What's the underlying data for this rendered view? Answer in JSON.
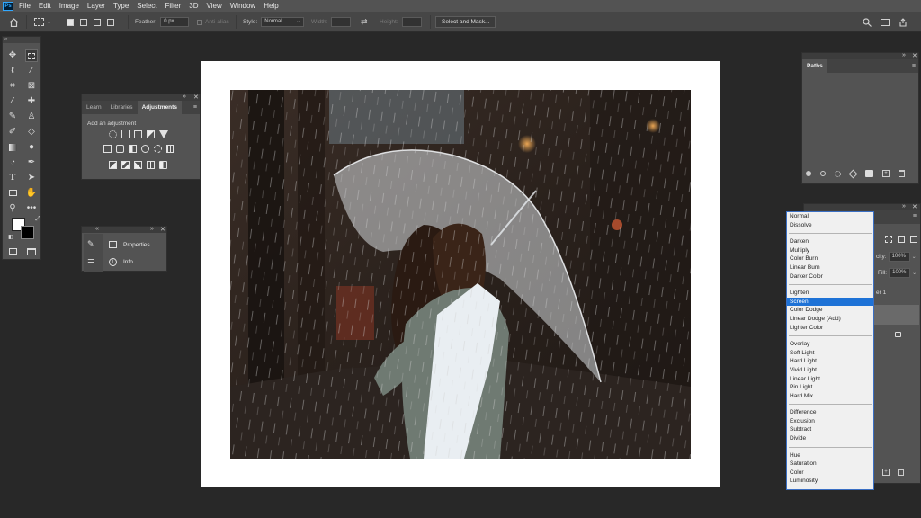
{
  "menubar": {
    "logo": "Ps",
    "items": [
      "File",
      "Edit",
      "Image",
      "Layer",
      "Type",
      "Select",
      "Filter",
      "3D",
      "View",
      "Window",
      "Help"
    ]
  },
  "options": {
    "feather_label": "Feather:",
    "feather_value": "0 px",
    "antialias_label": "Anti-alias",
    "style_label": "Style:",
    "style_value": "Normal",
    "width_label": "Width:",
    "height_label": "Height:",
    "select_mask_label": "Select and Mask..."
  },
  "adjustments_panel": {
    "tabs": [
      "Learn",
      "Libraries",
      "Adjustments"
    ],
    "active_tab": "Adjustments",
    "add_label": "Add an adjustment"
  },
  "properties_panel": {
    "items": [
      "Properties",
      "Info"
    ]
  },
  "paths_panel": {
    "tab": "Paths"
  },
  "layers_panel": {
    "opacity_label": "city:",
    "opacity_value": "100%",
    "fill_label": "Fill:",
    "fill_value": "100%",
    "layer_name": "er 1"
  },
  "blend_modes": {
    "groups": [
      [
        "Normal",
        "Dissolve"
      ],
      [
        "Darken",
        "Multiply",
        "Color Burn",
        "Linear Burn",
        "Darker Color"
      ],
      [
        "Lighten",
        "Screen",
        "Color Dodge",
        "Linear Dodge (Add)",
        "Lighter Color"
      ],
      [
        "Overlay",
        "Soft Light",
        "Hard Light",
        "Vivid Light",
        "Linear Light",
        "Pin Light",
        "Hard Mix"
      ],
      [
        "Difference",
        "Exclusion",
        "Subtract",
        "Divide"
      ],
      [
        "Hue",
        "Saturation",
        "Color",
        "Luminosity"
      ]
    ],
    "selected": "Screen"
  },
  "colors": {
    "foreground": "#ffffff",
    "background": "#000000",
    "selection": "#1e72d6"
  }
}
